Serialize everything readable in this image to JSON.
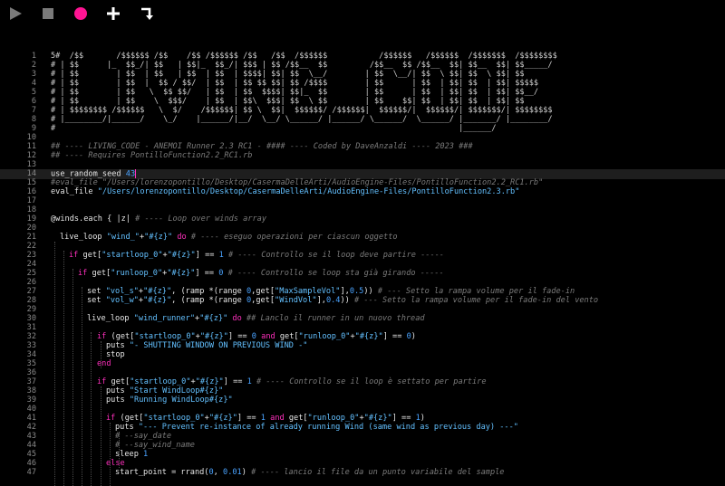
{
  "toolbar": {
    "buttons": [
      {
        "name": "play-button",
        "icon": "play-icon"
      },
      {
        "name": "stop-button",
        "icon": "stop-icon"
      },
      {
        "name": "record-button",
        "icon": "record-circle-icon"
      },
      {
        "name": "new-buffer-button",
        "icon": "plus-icon"
      },
      {
        "name": "jump-button",
        "icon": "bent-arrow-icon"
      }
    ],
    "colors": {
      "play": "#7a7a7a",
      "stop": "#7a7a7a",
      "record": "#ff1493",
      "plus": "#ffffff",
      "jump": "#ffffff"
    }
  },
  "editor": {
    "line_numbers": [
      "1",
      "2",
      "3",
      "4",
      "5",
      "6",
      "7",
      "8",
      "9",
      "10",
      "11",
      "12",
      "13",
      "14",
      "15",
      "16",
      "17",
      "18",
      "19",
      "20",
      "21",
      "22",
      "23",
      "24",
      "25",
      "26",
      "27",
      "28",
      "29",
      "30",
      "31",
      "32",
      "33",
      "34",
      "35",
      "36",
      "37",
      "38",
      "39",
      "40",
      "41",
      "42",
      "43",
      "44",
      "45",
      "46",
      "47"
    ],
    "ascii_art": [
      "5#  /$$       /$$$$$$ /$$    /$$ /$$$$$$ /$$   /$$  /$$$$$$           /$$$$$$   /$$$$$$  /$$$$$$$  /$$$$$$$$",
      "# | $$      |_  $$_/| $$   | $$|_  $$_/| $$$ | $$ /$$__  $$         /$$__  $$ /$$__  $$| $$__  $$| $$_____/",
      "# | $$        | $$  | $$   | $$  | $$  | $$$$| $$| $$  \\__/        | $$  \\__/| $$  \\ $$| $$  \\ $$| $$",
      "# | $$        | $$  |  $$ / $$/  | $$  | $$ $$ $$| $$ /$$$$        | $$      | $$  | $$| $$  | $$| $$$$$",
      "# | $$        | $$   \\  $$ $$/   | $$  | $$  $$$$| $$|_  $$        | $$      | $$  | $$| $$  | $$| $$__/",
      "# | $$        | $$    \\  $$$/    | $$  | $$\\  $$$| $$  \\ $$        | $$    $$| $$  | $$| $$  | $$| $$",
      "# | $$$$$$$$ /$$$$$$   \\  $/    /$$$$$$| $$ \\  $$|  $$$$$$/ /$$$$$$|  $$$$$$/|  $$$$$$/| $$$$$$$/| $$$$$$$$",
      "# |________/|______/    \\_/    |______/|__/  \\__/ \\______/ |______/ \\______/  \\______/ |_______/ |________/",
      "#                                                                                      |______/"
    ],
    "line11": "## ---- LIVING_CODE - ANEMOI Runner 2.3 RC1 - #### ---- Coded by DaveAnzaldi ---- 2023 ###",
    "line12": "## ---- Requires PontilloFunction2.2_RC1.rb",
    "line14": {
      "kw": "use_random_seed ",
      "num": "43"
    },
    "line15": "#eval_file \"/Users/lorenzopontillo/Desktop/CasermaDelleArti/AudioEngine-Files/PontilloFunction2.2_RC1.rb\"",
    "line16": {
      "kw": "eval_file ",
      "str": "\"/Users/lorenzopontillo/Desktop/CasermaDelleArti/AudioEngine-Files/PontilloFunction2.3.rb\""
    },
    "line19": {
      "sym": "@winds",
      "code": ".each { |z| ",
      "comment": "# ---- Loop over winds array"
    },
    "line21": {
      "kw": "live_loop ",
      "str": "\"wind_\"",
      "op": "+",
      "str2": "\"#{z}\"",
      "do": " do ",
      "comment": "# ---- eseguo operazioni per ciascun oggetto"
    },
    "line23": {
      "kw": "if ",
      "fn": "get[",
      "str": "\"startloop_0\"",
      "op": "+",
      "str2": "\"#{z}\"",
      "close": "] == ",
      "num": "1",
      "comment": " # ---- Controllo se il loop deve partire -----"
    },
    "line25": {
      "kw": "if ",
      "fn": "get[",
      "str": "\"runloop_0\"",
      "op": "+",
      "str2": "\"#{z}\"",
      "close": "] == ",
      "num": "0",
      "comment": " # ---- Controllo se loop sta già girando -----"
    },
    "line27": {
      "a": "set ",
      "s1": "\"vol_s\"",
      "b": "+",
      "s2": "\"#{z}\"",
      "c": ", (ramp *(range ",
      "n1": "0",
      "d": ",get[",
      "s3": "\"MaxSampleVol\"",
      "e": "],",
      "n2": "0.5",
      "f": ")) ",
      "comment": "# --- Setto la rampa volume per il fade-in"
    },
    "line28": {
      "a": "set ",
      "s1": "\"vol_w\"",
      "b": "+",
      "s2": "\"#{z}\"",
      "c": ", (ramp *(range ",
      "n1": "0",
      "d": ",get[",
      "s3": "\"WindVol\"",
      "e": "],",
      "n2": "0.4",
      "f": ")) ",
      "comment": "# --- Setto la rampa volume per il fade-in del vento"
    },
    "line30": {
      "kw": "live_loop ",
      "str": "\"wind_runner\"",
      "op": "+",
      "str2": "\"#{z}\"",
      "do": " do ",
      "comment": "## Lanclo il runner in un nuovo thread"
    },
    "line32": {
      "kw": "if ",
      "a": "(get[",
      "s1": "\"startloop_0\"",
      "b": "+",
      "s2": "\"#{z}\"",
      "c": "] == ",
      "n1": "0",
      "and": " and ",
      "d": "get[",
      "s3": "\"runloop_0\"",
      "e": "+",
      "s4": "\"#{z}\"",
      "f": "] == ",
      "n2": "0",
      "g": ")"
    },
    "line33": {
      "kw": "puts ",
      "str": "\"- SHUTTING WINDOW ON PREVIOUS WIND -\""
    },
    "line34": {
      "kw": "stop"
    },
    "line35": {
      "kw": "end"
    },
    "line37": {
      "kw": "if ",
      "fn": "get[",
      "str": "\"startloop_0\"",
      "op": "+",
      "str2": "\"#{z}\"",
      "close": "] == ",
      "num": "1",
      "comment": " # ---- Controllo se il loop è settato per partire"
    },
    "line38": {
      "kw": "puts ",
      "str": "\"Start WindLoop#{z}\""
    },
    "line39": {
      "kw": "puts ",
      "str": "\"Running WindLoop#{z}\""
    },
    "line41": {
      "kw": "if ",
      "a": "(get[",
      "s1": "\"startloop_0\"",
      "b": "+",
      "s2": "\"#{z}\"",
      "c": "] == ",
      "n1": "1",
      "and": " and ",
      "d": "get[",
      "s3": "\"runloop_0\"",
      "e": "+",
      "s4": "\"#{z}\"",
      "f": "] == ",
      "n2": "1",
      "g": ")"
    },
    "line42": {
      "kw": "puts ",
      "str": "\"--- Prevent re-instance of already running Wind (same wind as previous day) ---\""
    },
    "line43": "# --say_date",
    "line44": "# --say_wind_name",
    "line45": {
      "kw": "sleep ",
      "num": "1"
    },
    "line46": {
      "kw": "else"
    },
    "line47": {
      "a": "start_point = rrand(",
      "n1": "0",
      "b": ", ",
      "n2": "0.01",
      "c": ") ",
      "comment": "# ---- lancio il file da un punto variabile del sample"
    }
  }
}
